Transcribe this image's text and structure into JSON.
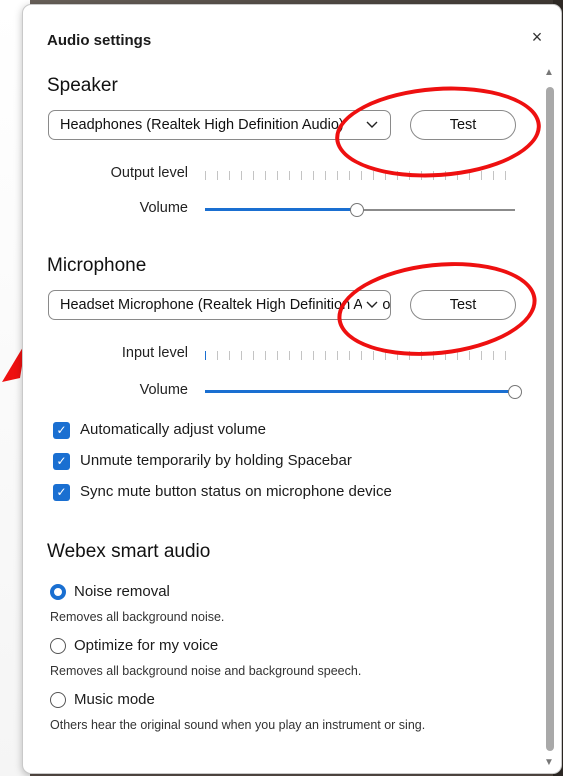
{
  "dialog": {
    "title": "Audio settings",
    "close_glyph": "×"
  },
  "speaker": {
    "section_title": "Speaker",
    "device": "Headphones (Realtek High Definition Audio)",
    "test_label": "Test",
    "output_level_label": "Output level",
    "volume_label": "Volume",
    "volume_fraction": 0.49
  },
  "microphone": {
    "section_title": "Microphone",
    "device": "Headset Microphone (Realtek High Definition Audio)",
    "test_label": "Test",
    "input_level_label": "Input level",
    "volume_label": "Volume",
    "volume_fraction": 1.0
  },
  "options": [
    {
      "label": "Automatically adjust volume",
      "checked": true
    },
    {
      "label": "Unmute temporarily by holding Spacebar",
      "checked": true
    },
    {
      "label": "Sync mute button status on microphone device",
      "checked": true
    }
  ],
  "smart_audio": {
    "section_title": "Webex smart audio",
    "modes": [
      {
        "label": "Noise removal",
        "description": "Removes all background noise.",
        "selected": true
      },
      {
        "label": "Optimize for my voice",
        "description": "Removes all background noise and background speech.",
        "selected": false
      },
      {
        "label": "Music mode",
        "description": "Others hear the original sound when you play an instrument or sing.",
        "selected": false
      }
    ]
  },
  "icons": {
    "chevron": "chevron-down-icon",
    "check": "checkmark-icon",
    "close": "close-icon"
  },
  "colors": {
    "accent": "#1a6fd1",
    "annotation": "#ee1010"
  }
}
